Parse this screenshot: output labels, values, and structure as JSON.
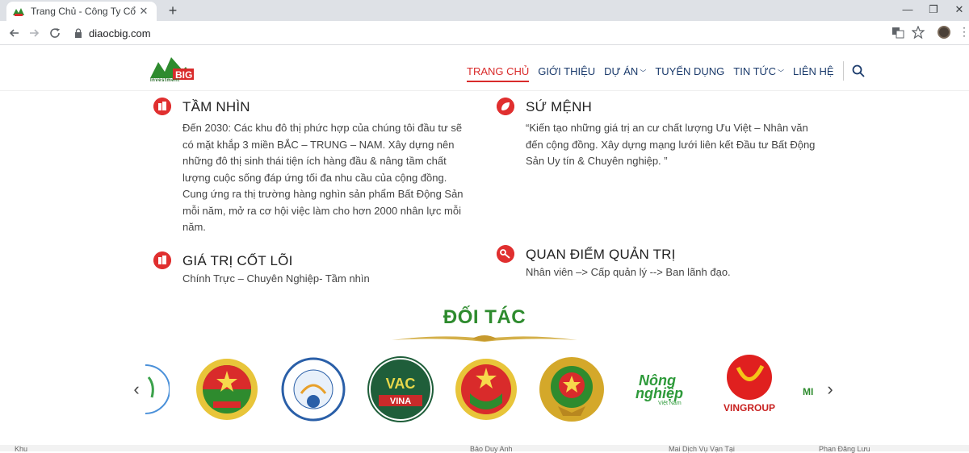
{
  "browser": {
    "tab_title": "Trang Chủ - Công Ty Cổ Phần Tậ",
    "tab_close": "✕",
    "new_tab": "+",
    "url": "diaocbig.com",
    "window_min": "—",
    "window_restore": "❐",
    "window_close": "✕"
  },
  "site": {
    "logo_text": "BIG",
    "logo_sub": "Investment",
    "nav": {
      "home": "TRANG CHỦ",
      "about": "GIỚI THIỆU",
      "projects": "DỰ ÁN",
      "careers": "TUYỂN DỤNG",
      "news": "TIN TỨC",
      "contact": "LIÊN HỆ"
    }
  },
  "sections": {
    "vision": {
      "title": "TẦM NHÌN",
      "text": "Đến 2030: Các khu đô thị phức hợp của chúng tôi đầu tư sẽ có mặt khắp 3 miền BẮC – TRUNG – NAM. Xây dựng nên những đô thị sinh thái tiện ích hàng đầu & nâng tầm chất lượng cuộc sống đáp ứng tối đa nhu cầu của cộng đồng. Cung ứng ra thị trường hàng nghìn sản phẩm Bất Động Sản mỗi năm, mở ra cơ hội việc làm cho hơn 2000 nhân lực mỗi năm."
    },
    "mission": {
      "title": "SỨ MỆNH",
      "text": "“Kiến tạo những giá trị an cư chất lượng Ưu Việt – Nhân văn đến cộng đồng. Xây dựng mạng lưới liên kết Đầu tư Bất Động Sản Uy tín & Chuyên nghiệp. ”"
    },
    "core_values": {
      "title": "GIÁ TRỊ CỐT LÕI",
      "text": "Chính Trực – Chuyên Nghiệp- Tầm nhìn"
    },
    "management": {
      "title": "QUAN ĐIỂM QUẢN TRỊ",
      "text": "Nhân viên –> Cấp quản lý --> Ban lãnh đạo."
    }
  },
  "partners": {
    "title": "ĐỐI TÁC",
    "prev": "‹",
    "next": "›",
    "logos": {
      "vac_text": "VAC",
      "vina_text": "VINA",
      "nong": "Nông",
      "nghiep": "nghiệp",
      "vietnam": "Việt Nam",
      "vingroup": "VINGROUP",
      "partial": "MI"
    }
  },
  "footer_strip": {
    "a": "Khu",
    "b": "Bảo Duy Anh",
    "c": "Mai Dịch Vụ Vạn Tại",
    "d": "Phan Đăng Lưu"
  }
}
